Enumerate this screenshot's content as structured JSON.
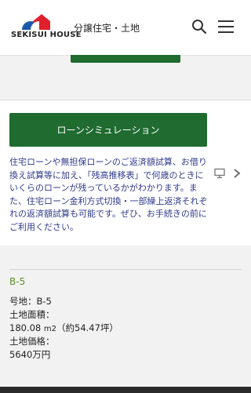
{
  "header": {
    "brand": "SEKISUI HOUSE",
    "section": "分譲住宅・土地",
    "search_icon": "search-icon",
    "menu_icon": "hamburger-menu-icon"
  },
  "loan_card": {
    "button_label": "ローンシミュレーション",
    "description": "住宅ローンや無担保ローンのご返済額試算、お借り換え試算等に加え、「残高推移表」で何歳のときにいくらのローンが残っているかがわかります。また、住宅ローン金利方式切換・一部繰上返済それぞれの返済額試算も可能です。ぜひ、お手続きの前にご利用ください。",
    "external_icon": "monitor-icon",
    "chevron_icon": "chevron-right-icon"
  },
  "lot": {
    "title": "B-5",
    "lot_number": "号地：B-5",
    "area_label": "土地面積：",
    "area_value": "180.08",
    "area_unit": "m2",
    "area_tsubo": "（約54.47坪）",
    "price_label": "土地価格：",
    "price_value": "5640万円"
  },
  "colors": {
    "accent_green": "#1f6b30",
    "link_blue": "#2f3a8a",
    "lot_title_green": "#5c8f2a",
    "logo_red": "#e0202a",
    "logo_blue": "#1a5aa8"
  }
}
